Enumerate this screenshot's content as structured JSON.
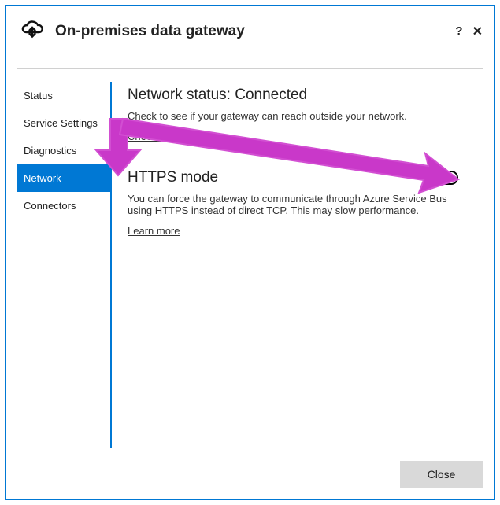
{
  "header": {
    "title": "On-premises data gateway"
  },
  "sidebar": {
    "items": [
      {
        "label": "Status"
      },
      {
        "label": "Service Settings"
      },
      {
        "label": "Diagnostics"
      },
      {
        "label": "Network"
      },
      {
        "label": "Connectors"
      }
    ]
  },
  "content": {
    "network_status_label": "Network status:",
    "network_status_value": "Connected",
    "network_status_desc": "Check to see if your gateway can reach outside your network.",
    "check_now": "Check now",
    "https_title": "HTTPS mode",
    "https_desc": "You can force the gateway to communicate through Azure Service Bus using HTTPS instead of direct TCP. This may slow performance.",
    "learn_more": "Learn more"
  },
  "footer": {
    "close_label": "Close"
  }
}
